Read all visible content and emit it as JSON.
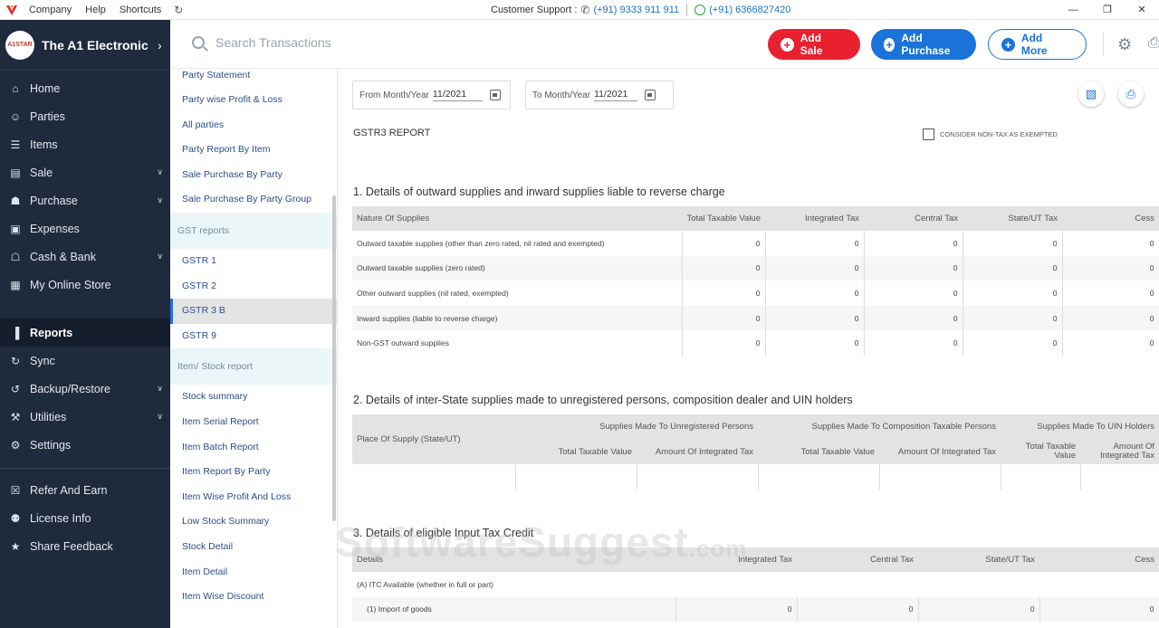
{
  "titlebar": {
    "menu": [
      "Company",
      "Help",
      "Shortcuts"
    ],
    "support_label": "Customer Support :",
    "phone1": "(+91) 9333 911 911",
    "phone2": "(+91) 6366827420"
  },
  "sidebar": {
    "company_name": "The A1 Electronic ...",
    "company_logo_text": "A1STAR",
    "items": [
      {
        "label": "Home",
        "icon": "home-icon"
      },
      {
        "label": "Parties",
        "icon": "parties-icon"
      },
      {
        "label": "Items",
        "icon": "items-icon"
      },
      {
        "label": "Sale",
        "icon": "sale-icon"
      },
      {
        "label": "Purchase",
        "icon": "cart-icon"
      },
      {
        "label": "Expenses",
        "icon": "wallet-icon"
      },
      {
        "label": "Cash & Bank",
        "icon": "bank-icon"
      },
      {
        "label": "My Online Store",
        "icon": "store-icon"
      },
      {
        "label": "Reports",
        "icon": "chart-icon"
      },
      {
        "label": "Sync",
        "icon": "sync-icon"
      },
      {
        "label": "Backup/Restore",
        "icon": "backup-icon"
      },
      {
        "label": "Utilities",
        "icon": "wrench-icon"
      },
      {
        "label": "Settings",
        "icon": "gear-icon"
      },
      {
        "label": "Refer And Earn",
        "icon": "gift-icon"
      },
      {
        "label": "License Info",
        "icon": "license-icon"
      },
      {
        "label": "Share Feedback",
        "icon": "star-icon"
      }
    ]
  },
  "topbar": {
    "search_placeholder": "Search Transactions",
    "add_sale": "Add Sale",
    "add_purchase": "Add Purchase",
    "add_more": "Add More"
  },
  "report_menu": {
    "party_items": [
      "Party Statement",
      "Party wise Profit & Loss",
      "All parties",
      "Party Report By Item",
      "Sale Purchase By Party",
      "Sale Purchase By Party Group"
    ],
    "gst_section": "GST reports",
    "gst_items": [
      "GSTR 1",
      "GSTR 2",
      "GSTR 3 B",
      "GSTR 9"
    ],
    "stock_section": "Item/ Stock report",
    "stock_items": [
      "Stock summary",
      "Item Serial Report",
      "Item Batch Report",
      "Item Report By Party",
      "Item Wise Profit And Loss",
      "Low Stock Summary",
      "Stock Detail",
      "Item Detail",
      "Item Wise Discount"
    ]
  },
  "filters": {
    "from_label": "From Month/Year",
    "from_value": "11/2021",
    "to_label": "To Month/Year",
    "to_value": "11/2021"
  },
  "report": {
    "title": "GSTR3 REPORT",
    "checkbox_label": "CONSIDER NON-TAX AS EXEMPTED",
    "section1": {
      "title": "1. Details of outward supplies and inward supplies liable to reverse charge",
      "headers": [
        "Nature Of Supplies",
        "Total Taxable Value",
        "Integrated Tax",
        "Central Tax",
        "State/UT Tax",
        "Cess"
      ],
      "rows": [
        [
          "Outward taxable supplies (other than zero rated, nil rated and exempted)",
          "0",
          "0",
          "0",
          "0",
          "0"
        ],
        [
          "Outward taxable supplies (zero rated)",
          "0",
          "0",
          "0",
          "0",
          "0"
        ],
        [
          "Other outward supplies (nil rated, exempted)",
          "0",
          "0",
          "0",
          "0",
          "0"
        ],
        [
          "Inward supplies (liable to reverse charge)",
          "0",
          "0",
          "0",
          "0",
          "0"
        ],
        [
          "Non-GST outward supplies",
          "0",
          "0",
          "0",
          "0",
          "0"
        ]
      ]
    },
    "section2": {
      "title": "2. Details of inter-State supplies made to unregistered persons, composition dealer and UIN holders",
      "place_header": "Place Of Supply (State/UT)",
      "group_headers": [
        "Supplies Made To Unregistered Persons",
        "Supplies Made To Composition Taxable Persons",
        "Supplies Made To UIN Holders"
      ],
      "sub_headers": [
        "Total Taxable Value",
        "Amount Of Integrated Tax",
        "Total Taxable Value",
        "Amount Of Integrated Tax",
        "Total Taxable Value",
        "Amount Of Integrated Tax"
      ]
    },
    "section3": {
      "title": "3. Details of eligible Input Tax Credit",
      "headers": [
        "Details",
        "Integrated Tax",
        "Central Tax",
        "State/UT Tax",
        "Cess"
      ],
      "group_row": "(A) ITC Available (whether in full or part)",
      "rows": [
        [
          "(1) Import of goods",
          "0",
          "0",
          "0",
          "0"
        ]
      ]
    }
  },
  "watermark": {
    "main": "SoftwareSuggest",
    "suffix": ".com"
  }
}
